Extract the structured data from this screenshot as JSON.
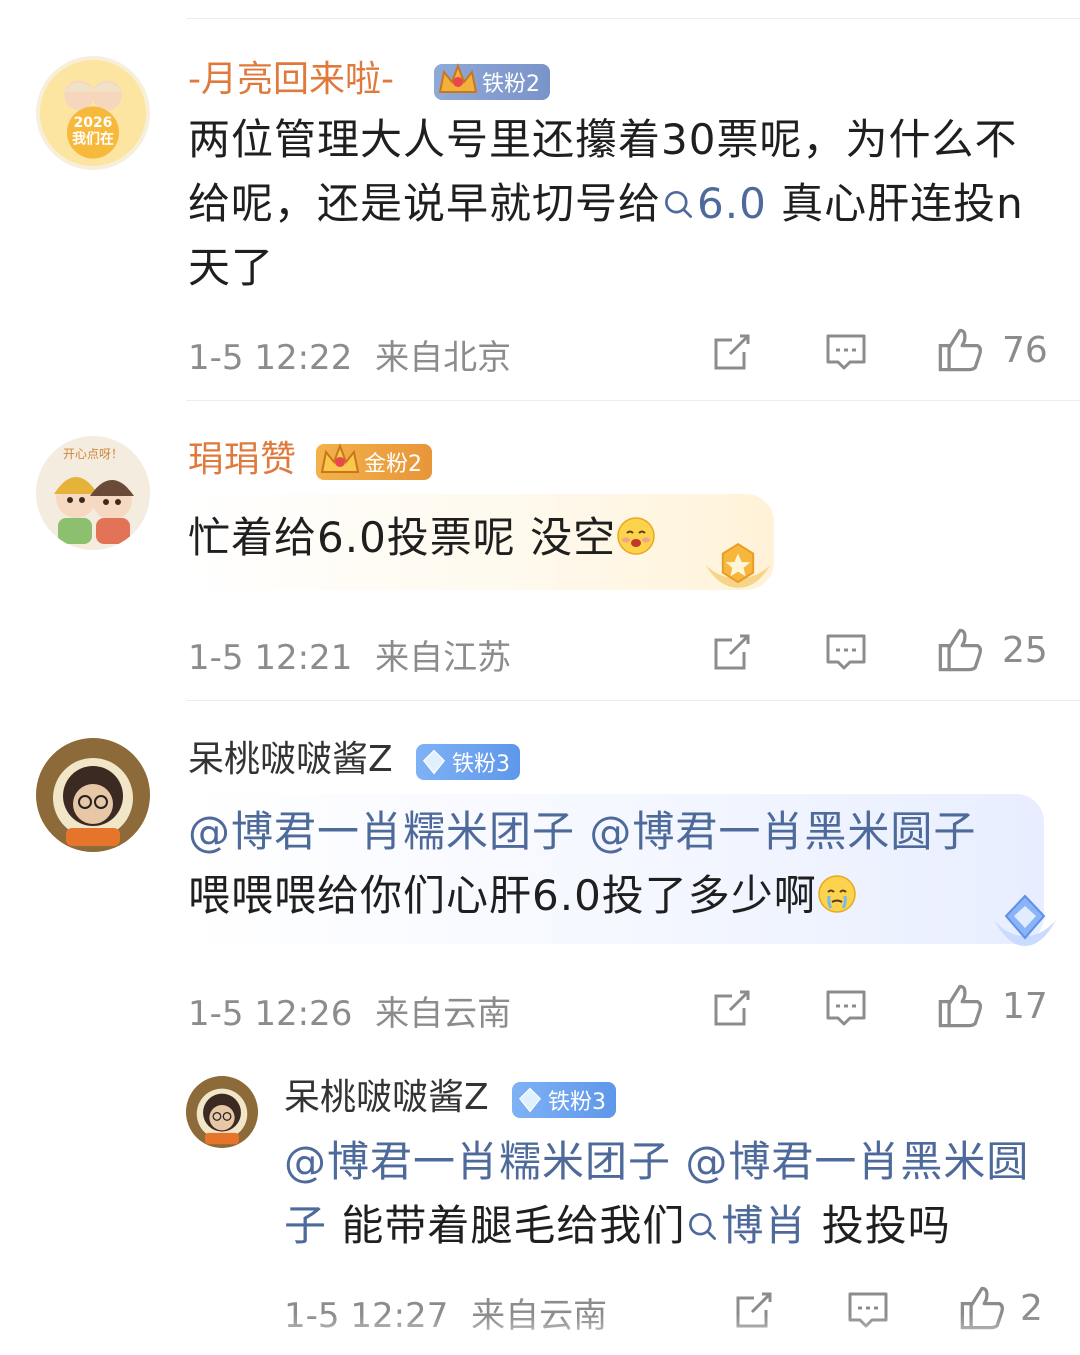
{
  "comments": [
    {
      "username": "-月亮回来啦-",
      "badge": "铁粉2",
      "text_pre": "两位管理大人号里还攥着30票呢，为什么不给呢，还是说早就切号给",
      "tag": "6.0",
      "text_post": " 真心肝连投n天了",
      "time": "1-5 12:22",
      "location": "来自北京",
      "likes": "76",
      "avatar_text": "2026 我们在"
    },
    {
      "username": "琄琄赞",
      "badge": "金粉2",
      "text": "忙着给6.0投票呢 没空",
      "time": "1-5 12:21",
      "location": "来自江苏",
      "likes": "25",
      "avatar_text": "开心点呀！"
    },
    {
      "username": "呆桃啵啵酱Z",
      "badge": "铁粉3",
      "mention1": "@博君一肖糯米团子",
      "mention2": "@博君一肖黑米圆子",
      "text": "喂喂喂给你们心肝6.0投了多少啊",
      "time": "1-5 12:26",
      "location": "来自云南",
      "likes": "17"
    },
    {
      "username": "呆桃啵啵酱Z",
      "badge": "铁粉3",
      "mention1": "@博君一肖糯米团子",
      "mention2_a": "@博君一肖黑米圆",
      "mention2_b": "子",
      "text_pre": " 能带着腿毛给我们",
      "tag": "博肖",
      "text_post": " 投投吗",
      "time": "1-5 12:27",
      "location": "来自云南",
      "likes": "2"
    }
  ],
  "colors": {
    "username_orange": "#e07a3c",
    "username_gray": "#333333",
    "link_blue": "#4e6a9b",
    "meta_gray": "#8c8c8c"
  },
  "icons": [
    "share-icon",
    "comment-icon",
    "like-icon",
    "search-icon"
  ]
}
